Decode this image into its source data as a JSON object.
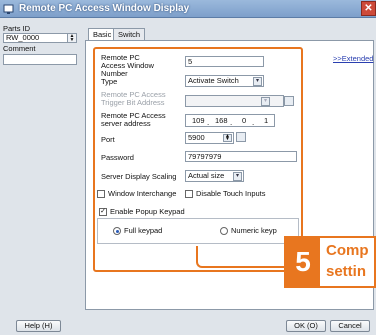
{
  "window": {
    "title": "Remote PC Access Window Display",
    "close_glyph": "✕"
  },
  "left_panel": {
    "parts_id_label": "Parts ID",
    "parts_id_value": "RW_0000",
    "comment_label": "Comment",
    "comment_value": ""
  },
  "tabs": [
    {
      "label": "Basic",
      "active": true
    },
    {
      "label": "Switch",
      "active": false
    }
  ],
  "extended_link": ">>Extended",
  "form": {
    "window_number_label": "Remote PC Access Window Number",
    "window_number_value": "5",
    "type_label": "Type",
    "type_value": "Activate Switch",
    "trigger_label": "Remote PC Access Trigger Bit Address",
    "server_label": "Remote PC Access server address",
    "ip": [
      "109",
      "168",
      "0",
      "1"
    ],
    "port_label": "Port",
    "port_value": "5900",
    "password_label": "Password",
    "password_value": "79797979",
    "scaling_label": "Server Display Scaling",
    "scaling_value": "Actual size",
    "window_interchange_label": "Window Interchange",
    "disable_touch_label": "Disable Touch Inputs",
    "enable_popup_label": "Enable Popup Keypad",
    "full_keypad_label": "Full keypad",
    "numeric_keypad_label": "Numeric keyp"
  },
  "callout": {
    "number": "5",
    "line1": "Comp",
    "line2": "settin"
  },
  "buttons": {
    "help": "Help (H)",
    "ok": "OK (O)",
    "cancel": "Cancel"
  },
  "colors": {
    "accent": "#e8761f",
    "link": "#2a3fb0"
  }
}
